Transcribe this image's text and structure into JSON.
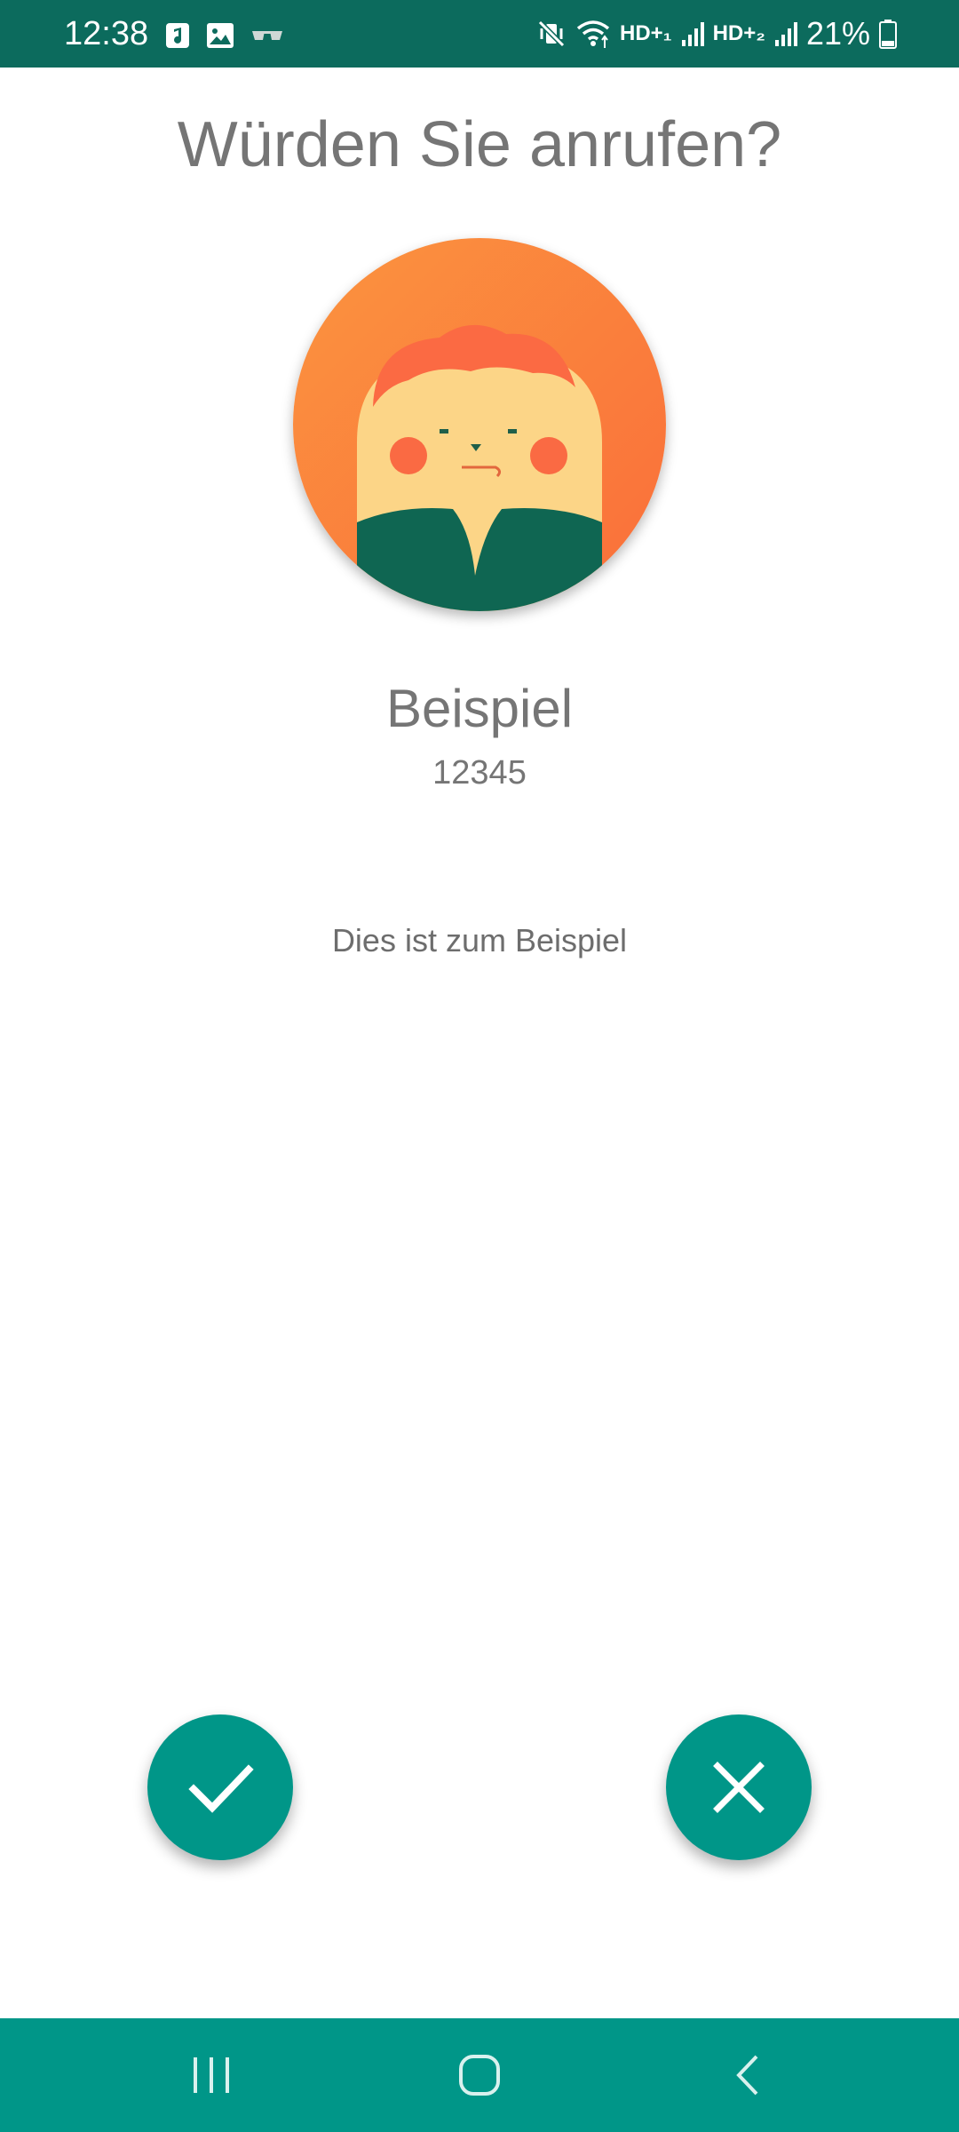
{
  "status_bar": {
    "time": "12:38",
    "left_icons": [
      "music-note-icon",
      "image-icon",
      "glasses-icon"
    ],
    "right_icons": [
      "mute-vibrate-icon",
      "wifi-icon",
      "signal-icon-1",
      "signal-icon-2",
      "battery-icon"
    ],
    "network_1": "HD+₁",
    "network_2": "HD+₂",
    "battery": "21%"
  },
  "dialog": {
    "title": "Würden Sie anrufen?",
    "avatar": "avatar-illustration",
    "contact_name": "Beispiel",
    "contact_number": "12345",
    "note": "Dies ist zum Beispiel"
  },
  "actions": {
    "accept": "check-icon",
    "decline": "close-icon"
  },
  "navigation": [
    "recent-apps-icon",
    "home-icon",
    "back-icon"
  ],
  "colors": {
    "status_bar": "#0c6b5d",
    "accent": "#009688",
    "text": "#757575",
    "avatar_orange": "#fb8c3f",
    "avatar_green": "#0f6652"
  }
}
